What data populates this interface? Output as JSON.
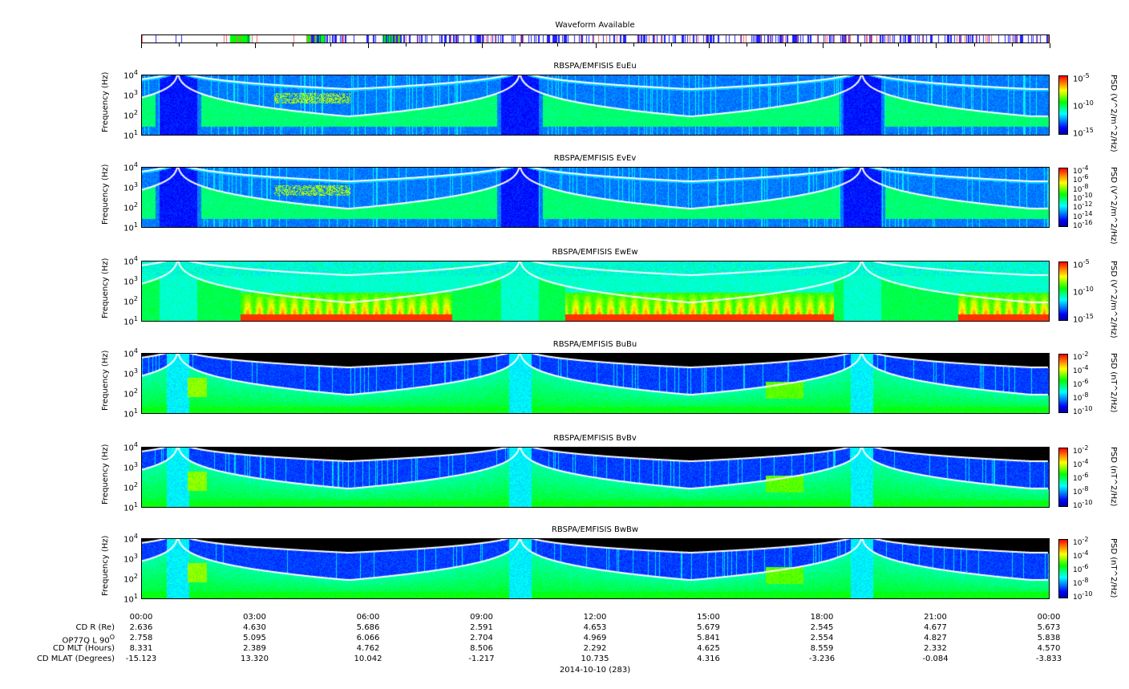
{
  "chart_data": {
    "type": "heatmap",
    "waveform": {
      "title": "Waveform Available",
      "legend_colors": {
        "burst": "#0000ff",
        "survey": "#ff6060",
        "continuous": "#00ff00"
      }
    },
    "x_range_hours": [
      0,
      24
    ],
    "panels": [
      {
        "title": "RBSPA/EMFISIS  EuEu",
        "ylabel": "Frequency (Hz)",
        "ylim": [
          10,
          10000
        ],
        "yticks": [
          "10",
          "10",
          "10",
          "10"
        ],
        "yexp": [
          "1",
          "2",
          "3",
          "4"
        ],
        "cbar_label": "PSD (V^2/m^2/Hz)",
        "cbar_ticks": [
          "-5",
          "-10",
          "-15"
        ],
        "kind": "E"
      },
      {
        "title": "RBSPA/EMFISIS  EvEv",
        "ylabel": "Frequency (Hz)",
        "ylim": [
          10,
          10000
        ],
        "yticks": [
          "10",
          "10",
          "10",
          "10"
        ],
        "yexp": [
          "1",
          "2",
          "3",
          "4"
        ],
        "cbar_label": "PSD (V^2/m^2/Hz)",
        "cbar_ticks": [
          "-4",
          "-6",
          "-8",
          "-10",
          "-12",
          "-14",
          "-16"
        ],
        "kind": "E"
      },
      {
        "title": "RBSPA/EMFISIS  EwEw",
        "ylabel": "Frequency (Hz)",
        "ylim": [
          10,
          10000
        ],
        "yticks": [
          "10",
          "10",
          "10",
          "10"
        ],
        "yexp": [
          "1",
          "2",
          "3",
          "4"
        ],
        "cbar_label": "PSD (V^2/m^2/Hz)",
        "cbar_ticks": [
          "-5",
          "-10",
          "-15"
        ],
        "kind": "Ew"
      },
      {
        "title": "RBSPA/EMFISIS  BuBu",
        "ylabel": "Frequency (Hz)",
        "ylim": [
          10,
          10000
        ],
        "yticks": [
          "10",
          "10",
          "10",
          "10"
        ],
        "yexp": [
          "1",
          "2",
          "3",
          "4"
        ],
        "cbar_label": "PSD (nT^2/Hz)",
        "cbar_ticks": [
          "-2",
          "-4",
          "-6",
          "-8",
          "-10"
        ],
        "kind": "B"
      },
      {
        "title": "RBSPA/EMFISIS  BvBv",
        "ylabel": "Frequency (Hz)",
        "ylim": [
          10,
          10000
        ],
        "yticks": [
          "10",
          "10",
          "10",
          "10"
        ],
        "yexp": [
          "1",
          "2",
          "3",
          "4"
        ],
        "cbar_label": "PSD (nT^2/Hz)",
        "cbar_ticks": [
          "-2",
          "-4",
          "-6",
          "-8",
          "-10"
        ],
        "kind": "B"
      },
      {
        "title": "RBSPA/EMFISIS  BwBw",
        "ylabel": "Frequency (Hz)",
        "ylim": [
          10,
          10000
        ],
        "yticks": [
          "10",
          "10",
          "10",
          "10"
        ],
        "yexp": [
          "1",
          "2",
          "3",
          "4"
        ],
        "cbar_label": "PSD (nT^2/Hz)",
        "cbar_ticks": [
          "-2",
          "-4",
          "-6",
          "-8",
          "-10"
        ],
        "kind": "B"
      }
    ],
    "xticks": [
      "00:00",
      "03:00",
      "06:00",
      "09:00",
      "12:00",
      "15:00",
      "18:00",
      "21:00",
      "00:00"
    ],
    "ephemeris": [
      {
        "label": "CD R (Re)",
        "values": [
          "2.636",
          "4.630",
          "5.686",
          "2.591",
          "4.653",
          "5.679",
          "2.545",
          "4.677",
          "5.673"
        ]
      },
      {
        "label": "OP77Q L 90",
        "sup": "O",
        "values": [
          "2.758",
          "5.095",
          "6.066",
          "2.704",
          "4.969",
          "5.841",
          "2.554",
          "4.827",
          "5.838"
        ]
      },
      {
        "label": "CD MLT (Hours)",
        "values": [
          "8.331",
          "2.389",
          "4.762",
          "8.506",
          "2.292",
          "4.625",
          "8.559",
          "2.332",
          "4.570"
        ]
      },
      {
        "label": "CD MLAT (Degrees)",
        "values": [
          "-15.123",
          "13.320",
          "10.042",
          "-1.217",
          "10.735",
          "4.316",
          "-3.236",
          "-0.084",
          "-3.833"
        ]
      }
    ],
    "xlabel": "2014-10-10 (283)"
  }
}
